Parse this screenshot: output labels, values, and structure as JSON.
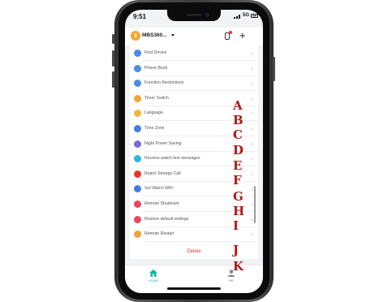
{
  "status": {
    "time": "9:51",
    "network": "5G"
  },
  "header": {
    "device_name": "MBS360...",
    "add_label": "+"
  },
  "colors": {
    "accent": "#12b3a8",
    "delete": "#e5352f",
    "annotation": "#b01818"
  },
  "menu": [
    {
      "label": "Find Device",
      "icon": "find-device-icon",
      "color": "#4b8de8"
    },
    {
      "label": "Phone Book",
      "icon": "phone-book-icon",
      "color": "#4b8de8"
    },
    {
      "label": "Function Restrictions",
      "icon": "restrictions-icon",
      "color": "#4b8de8"
    },
    {
      "label": "Timer Switch",
      "icon": "timer-icon",
      "color": "#f2a33a"
    },
    {
      "label": "Language",
      "icon": "language-icon",
      "color": "#f2b53a"
    },
    {
      "label": "Time Zone",
      "icon": "timezone-icon",
      "color": "#3f7ee0"
    },
    {
      "label": "Night Power Saving",
      "icon": "moon-icon",
      "color": "#7a6ae0"
    },
    {
      "label": "Receive watch text messages",
      "icon": "message-icon",
      "color": "#2bb8d9"
    },
    {
      "label": "Reject Strange Call",
      "icon": "reject-call-icon",
      "color": "#e5352f"
    },
    {
      "label": "Set Watch WiFi",
      "icon": "wifi-icon",
      "color": "#3f7ee0"
    },
    {
      "label": "Remote Shutdown",
      "icon": "power-icon",
      "color": "#e8475f"
    },
    {
      "label": "Restore default settings",
      "icon": "restore-icon",
      "color": "#e8475f"
    },
    {
      "label": "Remote Restart",
      "icon": "restart-icon",
      "color": "#f2a33a"
    }
  ],
  "delete_label": "Delete",
  "tabs": [
    {
      "label": "HOME",
      "icon": "home-icon"
    },
    {
      "label": "ME",
      "icon": "user-icon"
    }
  ],
  "annotations": [
    "A",
    "B",
    "C",
    "D",
    "E",
    "F",
    "G",
    "H",
    "I",
    "J",
    "K"
  ]
}
